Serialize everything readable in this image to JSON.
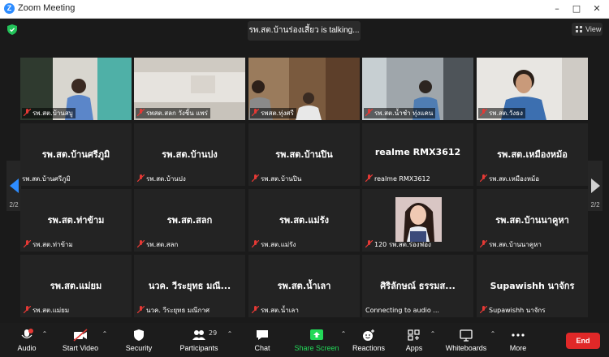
{
  "window": {
    "title": "Zoom Meeting"
  },
  "banner": {
    "speaking_text": "รพ.สต.บ้านร่องเสี้ยว is talking..."
  },
  "view_button": {
    "label": "View"
  },
  "pager": {
    "left_label": "2/2",
    "right_label": "2/2"
  },
  "tiles": [
    {
      "big": "",
      "name": "รพ.สต.บ้านสบู"
    },
    {
      "big": "",
      "name": "รพสต.สลก วังชิ้น แพร่"
    },
    {
      "big": "",
      "name": "รพสต.ทุ่งศรี"
    },
    {
      "big": "",
      "name": "รพ.สต.น้ำชำ ทุ่งแคน"
    },
    {
      "big": "",
      "name": "รพ.สต.วังธง"
    },
    {
      "big": "รพ.สต.บ้านศรีภูมิ",
      "name": "รพ.สต.บ้านศรีภูมิ"
    },
    {
      "big": "รพ.สต.บ้านปง",
      "name": "รพ.สต.บ้านปง"
    },
    {
      "big": "รพ.สต.บ้านปิน",
      "name": "รพ.สต.บ้านปิน"
    },
    {
      "big": "realme RMX3612",
      "name": "realme RMX3612"
    },
    {
      "big": "รพ.สต.เหมืองหม้อ",
      "name": "รพ.สต.เหมืองหม้อ"
    },
    {
      "big": "รพ.สต.ท่าข้าม",
      "name": "รพ.สต.ท่าข้าม"
    },
    {
      "big": "รพ.สต.สลก",
      "name": "รพ.สต.สลก"
    },
    {
      "big": "รพ.สต.แม่รัง",
      "name": "รพ.สต.แม่รัง"
    },
    {
      "big": "",
      "name": "120 รพ.สต.ร่องฟอง"
    },
    {
      "big": "รพ.สต.บ้านนาคูหา",
      "name": "รพ.สต.บ้านนาคูหา"
    },
    {
      "big": "รพ.สต.แม่ยม",
      "name": "รพ.สต.แม่ยม"
    },
    {
      "big": "นวค. วีระยุทธ มณี...",
      "name": "นวค. วีระยุทธ มณีกาศ"
    },
    {
      "big": "รพ.สต.น้ำเลา",
      "name": "รพ.สต.น้ำเลา"
    },
    {
      "big": "ศิริลักษณ์ ธรรมส...",
      "name": "Connecting to audio ..."
    },
    {
      "big": "Supawishh นาจักร",
      "name": "Supawishh นาจักร"
    }
  ],
  "toolbar": {
    "audio": "Audio",
    "start_video": "Start Video",
    "security": "Security",
    "participants": "Participants",
    "participants_count": "29",
    "chat": "Chat",
    "share_screen": "Share Screen",
    "reactions": "Reactions",
    "apps": "Apps",
    "whiteboards": "Whiteboards",
    "more": "More",
    "end": "End"
  },
  "colors": {
    "share_green": "#23d959",
    "end_red": "#e02828",
    "mute_red": "#e53935",
    "zoom_blue": "#2d8cff"
  }
}
